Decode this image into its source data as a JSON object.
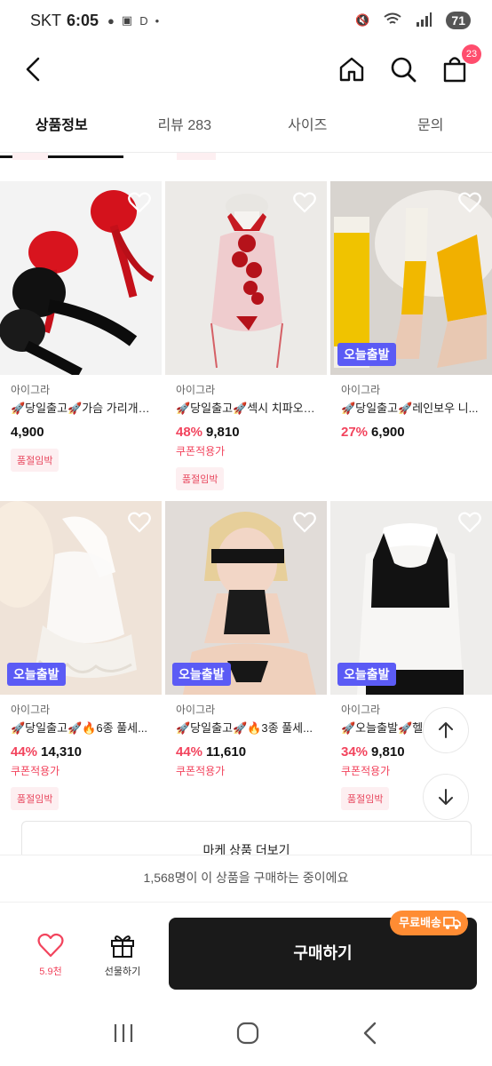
{
  "status": {
    "carrier": "SKT",
    "time": "6:05",
    "extra": "D",
    "battery": "71"
  },
  "nav": {
    "cart_badge": "23"
  },
  "tabs": [
    "상품정보",
    "리뷰 283",
    "사이즈",
    "문의"
  ],
  "products": [
    {
      "brand": "아이그라",
      "title": "🚀당일출고🚀가슴 가리개 ...",
      "discount": "",
      "price": "4,900",
      "coupon": "",
      "soldout": "품절임박",
      "today_tag": "",
      "image": "red-black-tassel-pasties"
    },
    {
      "brand": "아이그라",
      "title": "🚀당일출고🚀섹시 치파오 ...",
      "discount": "48%",
      "price": "9,810",
      "coupon": "쿠폰적용가",
      "soldout": "품절임박",
      "today_tag": "",
      "image": "red-sheer-qipao-lingerie"
    },
    {
      "brand": "아이그라",
      "title": "🚀당일출고🚀레인보우 니...",
      "discount": "27%",
      "price": "6,900",
      "coupon": "",
      "soldout": "",
      "today_tag": "오늘출발",
      "image": "yellow-youth-knee-socks"
    },
    {
      "brand": "아이그라",
      "title": "🚀당일출고🚀🔥6종 풀세...",
      "discount": "44%",
      "price": "14,310",
      "coupon": "쿠폰적용가",
      "soldout": "품절임박",
      "today_tag": "오늘출발",
      "image": "white-lace-babydoll"
    },
    {
      "brand": "아이그라",
      "title": "🚀당일출고🚀🔥3종 풀세...",
      "discount": "44%",
      "price": "11,610",
      "coupon": "쿠폰적용가",
      "soldout": "",
      "today_tag": "오늘출발",
      "image": "black-lace-set-model"
    },
    {
      "brand": "아이그라",
      "title": "🚀오늘출발🚀헬",
      "discount": "34%",
      "price": "9,810",
      "coupon": "쿠폰적용가",
      "soldout": "품절임박",
      "today_tag": "오늘출발",
      "image": "black-sports-bra"
    }
  ],
  "more_button": "마케 상품 더보기",
  "purchase_notice": "1,568명이 이 상품을 구매하는 중이에요",
  "bottom": {
    "likes": "5.9천",
    "gift_label": "선물하기",
    "buy_label": "구매하기",
    "shipping_badge": "무료배송"
  },
  "icons": {
    "back": "chevron-left-icon",
    "home": "home-icon",
    "search": "search-icon",
    "cart": "shopping-bag-icon",
    "heart": "heart-icon",
    "gift": "gift-icon",
    "scroll_up": "arrow-up-icon",
    "scroll_down": "arrow-down-icon"
  },
  "colors": {
    "accent_red": "#f2445d",
    "today_tag": "#5b5bf5",
    "shipping_orange": "#ff8c33",
    "buy_button": "#1a1a1a"
  }
}
